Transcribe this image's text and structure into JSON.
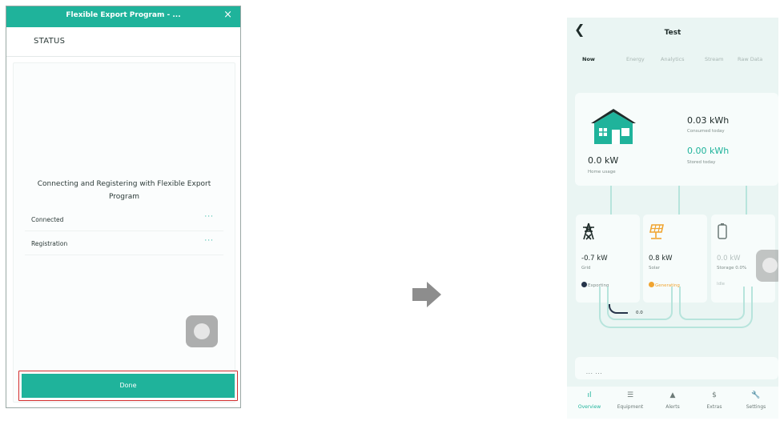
{
  "left_phone": {
    "dialog_title": "Flexible Export Program - ...",
    "close_symbol": "×",
    "section": "STATUS",
    "message": "Connecting and Registering with Flexible Export Program",
    "rows": [
      {
        "label": "Connected",
        "state": "···"
      },
      {
        "label": "Registration",
        "state": "···"
      }
    ],
    "done_label": "Done",
    "accent": "#1fb39b",
    "highlight_color": "#d32f2f"
  },
  "right_phone": {
    "title": "Test",
    "tabs": [
      "Now",
      "Energy",
      "Analytics",
      "Stream",
      "Raw Data"
    ],
    "active_tab": "Now",
    "home": {
      "power": "0.0 kW",
      "label": "Home usage"
    },
    "consumed": {
      "value": "0.03 kWh",
      "label": "Consumed today"
    },
    "stored": {
      "value": "0.00 kWh",
      "label": "Stored today"
    },
    "cards": [
      {
        "icon": "transmission-tower-icon",
        "power": "-0.7 kW",
        "name": "Grid",
        "status": "Exporting",
        "status_color": "#26344a"
      },
      {
        "icon": "solar-panel-icon",
        "power": "0.8 kW",
        "name": "Solar",
        "status": "Generating",
        "status_color": "#f0a430"
      },
      {
        "icon": "battery-icon",
        "power": "0.0 kW",
        "name": "Storage 0.0%",
        "status": "Idle",
        "status_color": "#b5c1bf"
      }
    ],
    "mini_value": "0.0",
    "bottom_text": "... ...",
    "nav": [
      {
        "label": "Overview",
        "icon": "bar-chart-icon",
        "glyph": "ıl"
      },
      {
        "label": "Equipment",
        "icon": "list-icon",
        "glyph": "☰"
      },
      {
        "label": "Alerts",
        "icon": "bell-icon",
        "glyph": "▲"
      },
      {
        "label": "Extras",
        "icon": "dollar-icon",
        "glyph": "$"
      },
      {
        "label": "Settings",
        "icon": "wrench-icon",
        "glyph": "🔧"
      }
    ],
    "active_nav": "Overview",
    "accent": "#1fb39b"
  }
}
